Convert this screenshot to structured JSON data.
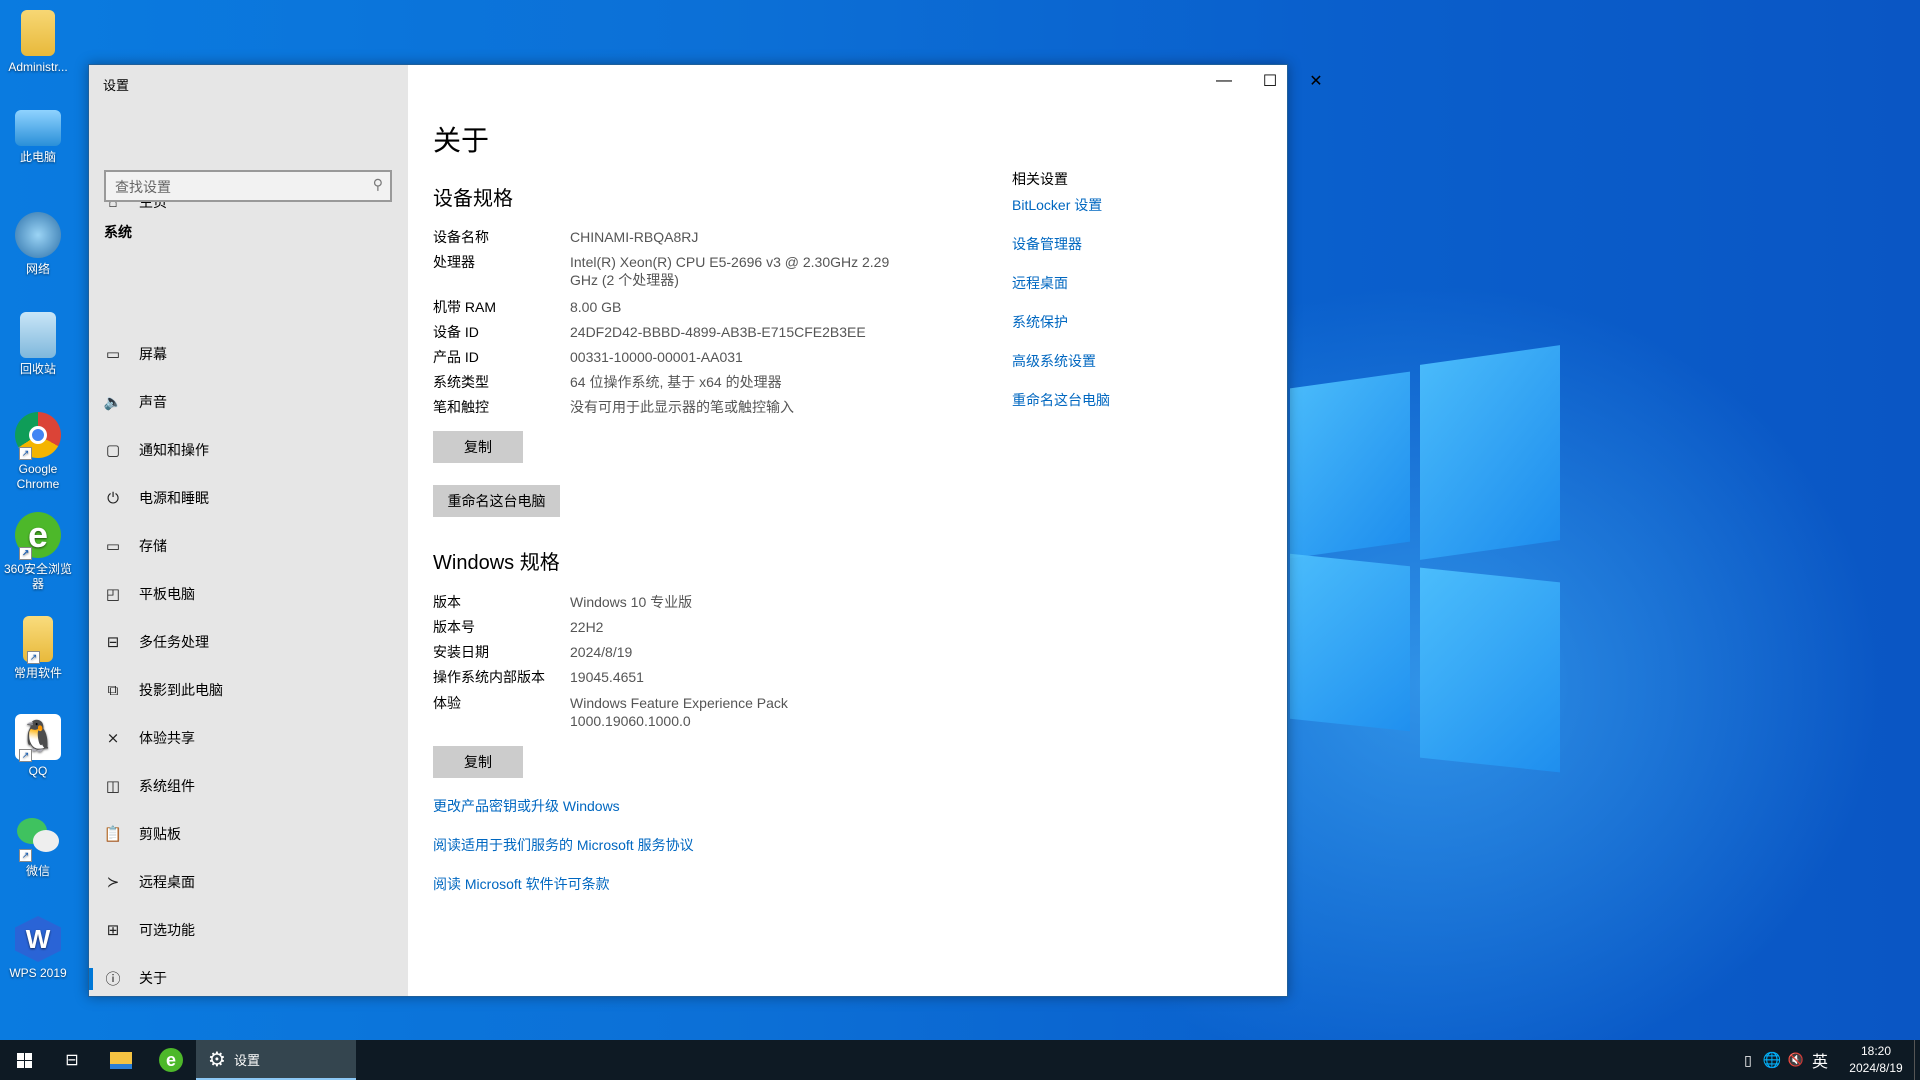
{
  "desktop": {
    "icons": [
      {
        "label": "Administr...",
        "icon": "user-folder-icon"
      },
      {
        "label": "此电脑",
        "icon": "computer-icon"
      },
      {
        "label": "网络",
        "icon": "network-icon"
      },
      {
        "label": "回收站",
        "icon": "recycle-bin-icon"
      },
      {
        "label": "Google Chrome",
        "icon": "chrome-icon"
      },
      {
        "label": "360安全浏览器",
        "icon": "360-browser-icon"
      },
      {
        "label": "常用软件",
        "icon": "folder-icon"
      },
      {
        "label": "QQ",
        "icon": "qq-icon"
      },
      {
        "label": "微信",
        "icon": "wechat-icon"
      },
      {
        "label": "WPS 2019",
        "icon": "wps-icon"
      }
    ]
  },
  "window": {
    "title": "设置",
    "controls": {
      "minimize": "—",
      "maximize": "☐",
      "close": "✕"
    }
  },
  "sidebar": {
    "home": {
      "label": "主页",
      "icon": "home-icon"
    },
    "search": {
      "placeholder": "查找设置",
      "icon": "search-icon"
    },
    "section": "系统",
    "items": [
      {
        "label": "屏幕",
        "icon": "monitor-icon",
        "glyph": "▭"
      },
      {
        "label": "声音",
        "icon": "speaker-icon",
        "glyph": "🔈"
      },
      {
        "label": "通知和操作",
        "icon": "notification-icon",
        "glyph": "▢"
      },
      {
        "label": "电源和睡眠",
        "icon": "power-icon",
        "glyph": "⏻"
      },
      {
        "label": "存储",
        "icon": "storage-icon",
        "glyph": "▭"
      },
      {
        "label": "平板电脑",
        "icon": "tablet-icon",
        "glyph": "◰"
      },
      {
        "label": "多任务处理",
        "icon": "multitasking-icon",
        "glyph": "⊟"
      },
      {
        "label": "投影到此电脑",
        "icon": "project-icon",
        "glyph": "⧉"
      },
      {
        "label": "体验共享",
        "icon": "share-icon",
        "glyph": "⨯"
      },
      {
        "label": "系统组件",
        "icon": "components-icon",
        "glyph": "◫"
      },
      {
        "label": "剪贴板",
        "icon": "clipboard-icon",
        "glyph": "📋"
      },
      {
        "label": "远程桌面",
        "icon": "remote-desktop-icon",
        "glyph": "≻"
      },
      {
        "label": "可选功能",
        "icon": "optional-features-icon",
        "glyph": "⊞"
      },
      {
        "label": "关于",
        "icon": "info-icon",
        "glyph": "ⓘ",
        "selected": true
      }
    ]
  },
  "main": {
    "title": "关于",
    "device_specs": {
      "heading": "设备规格",
      "rows": [
        {
          "label": "设备名称",
          "value": "CHINAMI-RBQA8RJ"
        },
        {
          "label": "处理器",
          "value": "Intel(R) Xeon(R) CPU E5-2696 v3 @ 2.30GHz   2.29 GHz  (2 个处理器)"
        },
        {
          "label": "机带 RAM",
          "value": "8.00 GB"
        },
        {
          "label": "设备 ID",
          "value": "24DF2D42-BBBD-4899-AB3B-E715CFE2B3EE"
        },
        {
          "label": "产品 ID",
          "value": "00331-10000-00001-AA031"
        },
        {
          "label": "系统类型",
          "value": "64 位操作系统, 基于 x64 的处理器"
        },
        {
          "label": "笔和触控",
          "value": "没有可用于此显示器的笔或触控输入"
        }
      ],
      "copy_button": "复制",
      "rename_button": "重命名这台电脑"
    },
    "windows_specs": {
      "heading": "Windows 规格",
      "rows": [
        {
          "label": "版本",
          "value": "Windows 10 专业版"
        },
        {
          "label": "版本号",
          "value": "22H2"
        },
        {
          "label": "安装日期",
          "value": "2024/8/19"
        },
        {
          "label": "操作系统内部版本",
          "value": "19045.4651"
        },
        {
          "label": "体验",
          "value": "Windows Feature Experience Pack 1000.19060.1000.0"
        }
      ],
      "copy_button": "复制"
    },
    "links": [
      "更改产品密钥或升级 Windows",
      "阅读适用于我们服务的 Microsoft 服务协议",
      "阅读 Microsoft 软件许可条款"
    ],
    "related": {
      "heading": "相关设置",
      "links": [
        "BitLocker 设置",
        "设备管理器",
        "远程桌面",
        "系统保护",
        "高级系统设置",
        "重命名这台电脑"
      ]
    }
  },
  "taskbar": {
    "active_app": "设置",
    "clock": {
      "time": "18:20",
      "date": "2024/8/19"
    },
    "ime": "英"
  },
  "colors": {
    "accent": "#0078d7",
    "link": "#0067c0",
    "taskbar": "#0e1a24"
  }
}
